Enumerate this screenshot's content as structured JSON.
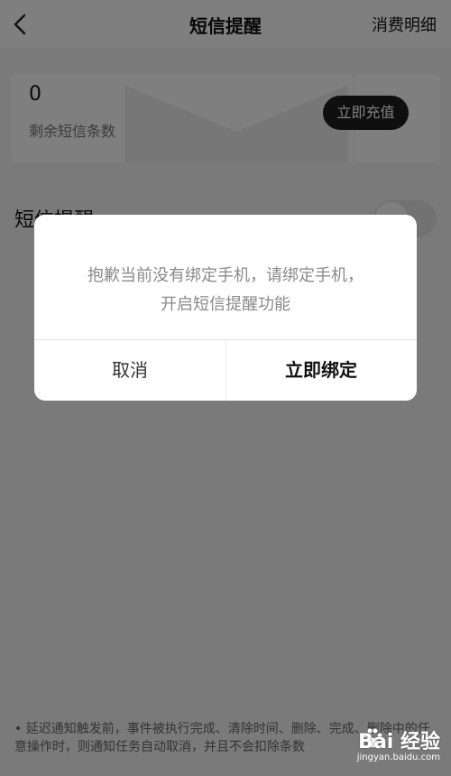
{
  "header": {
    "title": "短信提醒",
    "detail_link": "消费明细"
  },
  "balance_card": {
    "count": "0",
    "count_label": "剩余短信条数",
    "recharge_button": "立即充值"
  },
  "settings": {
    "sms_reminder_label": "短信提醒"
  },
  "footnote": {
    "text": "• 延迟通知触发前，事件被执行完成、清除时间、删除、完成、删除中的任意操作时，则通知任务自动取消，并且不会扣除条数"
  },
  "dialog": {
    "message_line1": "抱歉当前没有绑定手机，请绑定手机，",
    "message_line2": "开启短信提醒功能",
    "cancel": "取消",
    "confirm": "立即绑定"
  },
  "watermark": {
    "brand": "Bai 经验",
    "url": "jingyan.baidu.com"
  },
  "colors": {
    "overlay": "#000000",
    "button_dark": "#1f1f1f",
    "dialog_bg": "#ffffff"
  }
}
